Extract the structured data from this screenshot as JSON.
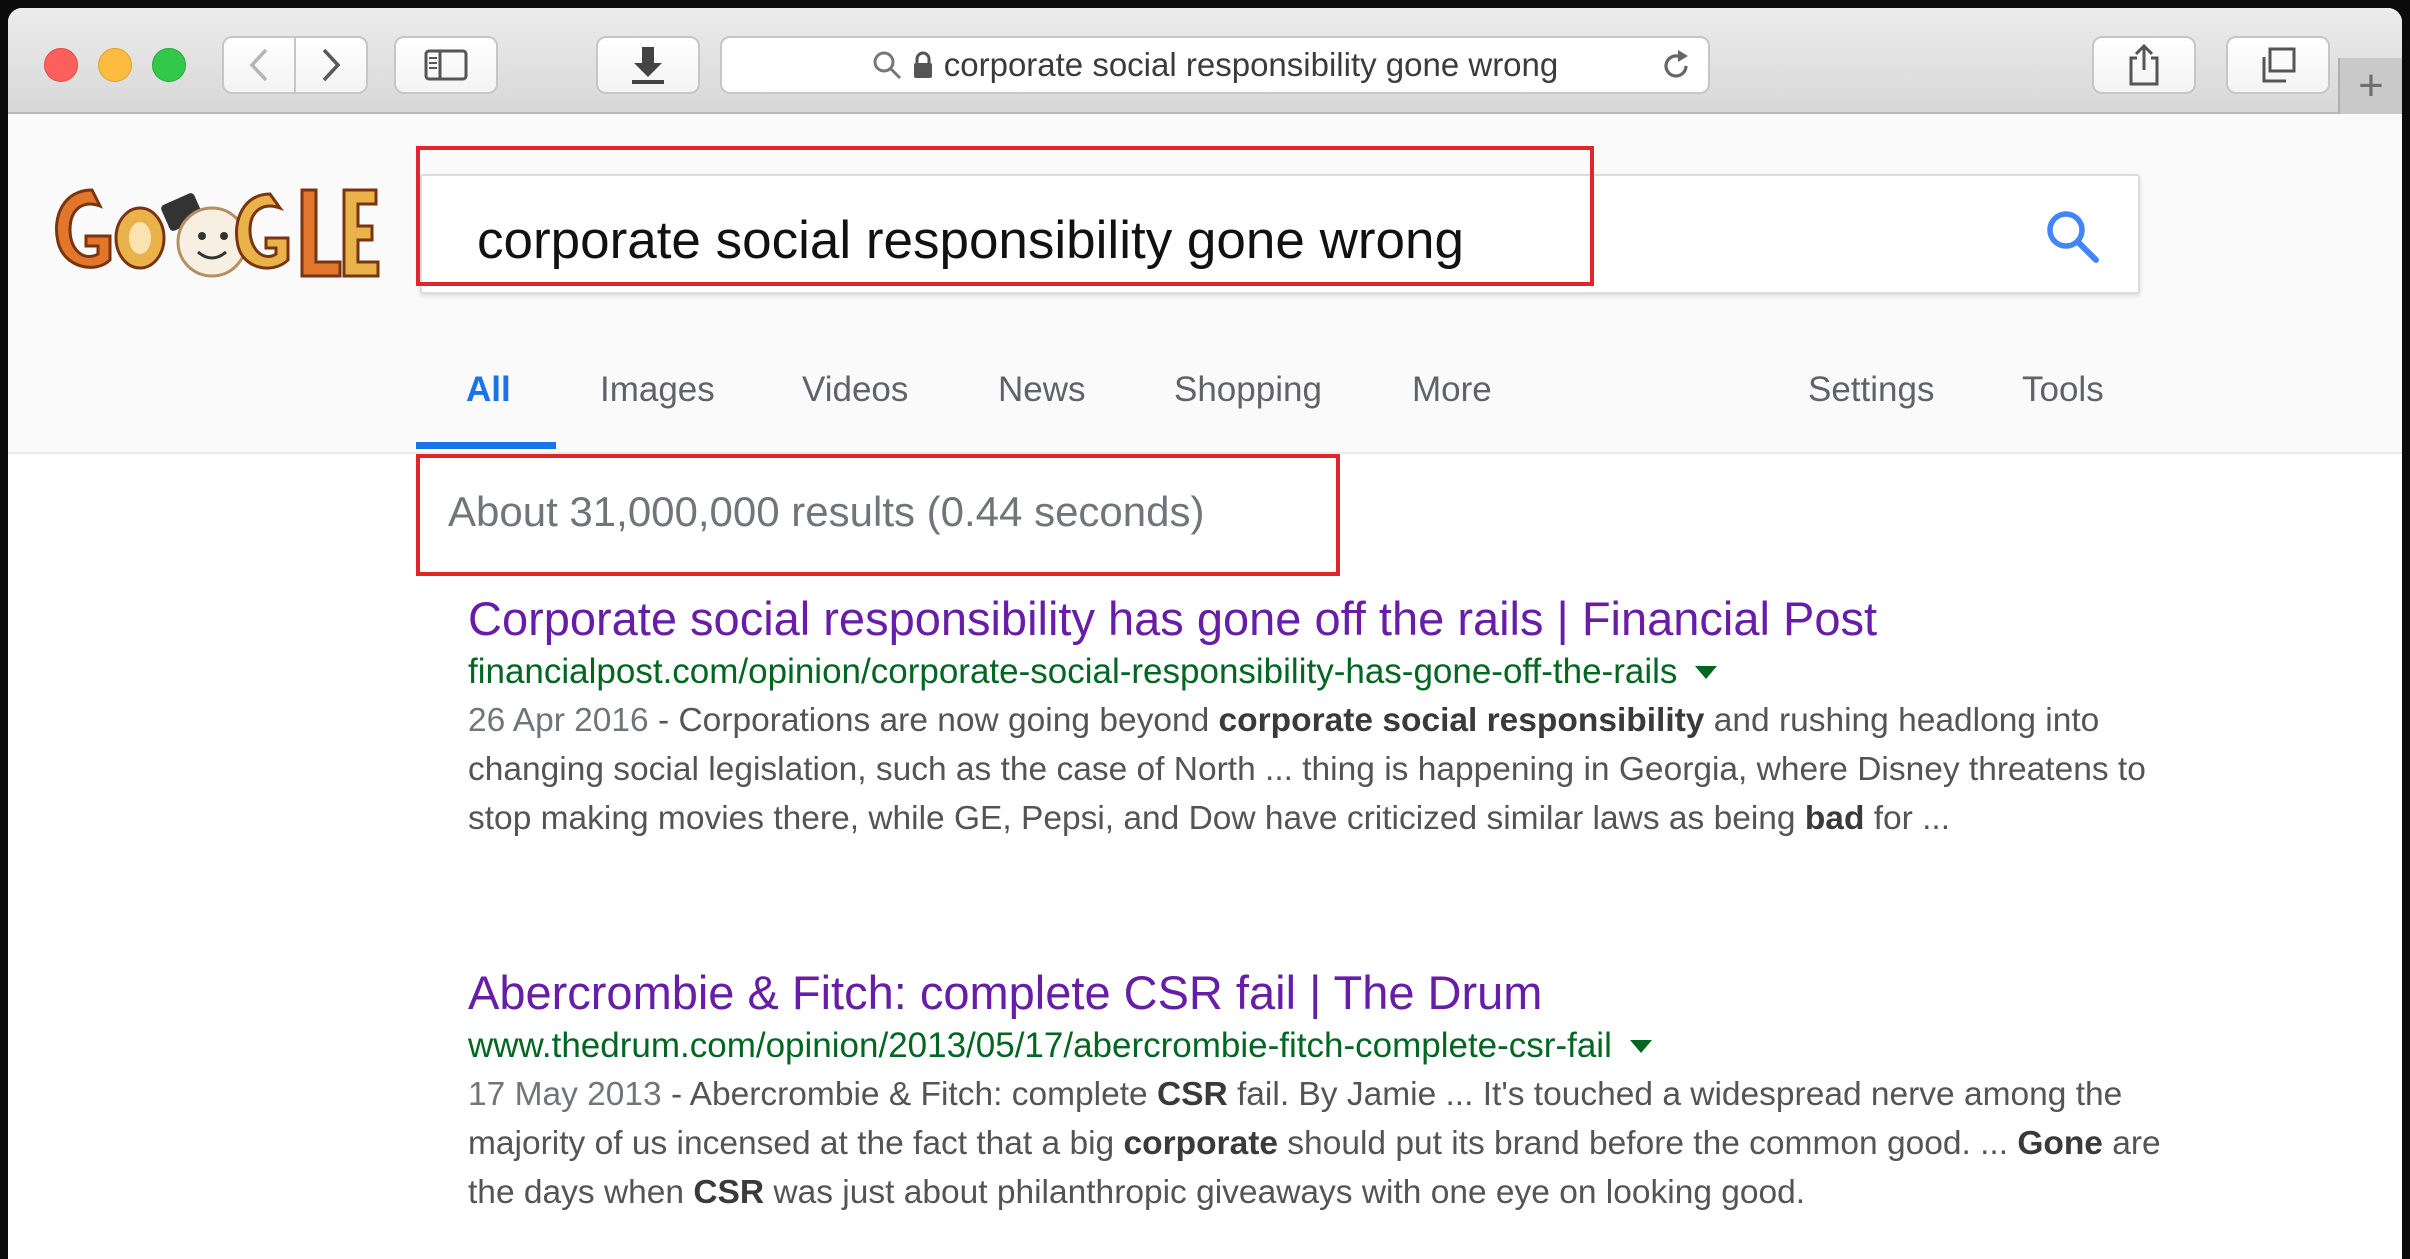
{
  "browser": {
    "address": "corporate social responsibility gone wrong",
    "new_tab_glyph": "+"
  },
  "google": {
    "query": "corporate social responsibility gone wrong",
    "tabs": [
      {
        "label": "All",
        "active": true
      },
      {
        "label": "Images"
      },
      {
        "label": "Videos"
      },
      {
        "label": "News"
      },
      {
        "label": "Shopping"
      },
      {
        "label": "More"
      },
      {
        "label": "Settings"
      },
      {
        "label": "Tools"
      }
    ],
    "stats": "About 31,000,000 results (0.44 seconds)"
  },
  "results": [
    {
      "title": "Corporate social responsibility has gone off the rails | Financial Post",
      "url": "financialpost.com/opinion/corporate-social-responsibility-has-gone-off-the-rails",
      "date": "26 Apr 2016",
      "snippet_parts": [
        {
          "t": " - Corporations are now going beyond "
        },
        {
          "t": "corporate social responsibility",
          "b": true
        },
        {
          "t": " and rushing headlong into changing social legislation, such as the case of North ... thing is happening in Georgia, where Disney threatens to stop making movies there, while GE, Pepsi, and Dow have criticized similar laws as being "
        },
        {
          "t": "bad",
          "b": true
        },
        {
          "t": " for ..."
        }
      ]
    },
    {
      "title": "Abercrombie & Fitch: complete CSR fail | The Drum",
      "url": "www.thedrum.com/opinion/2013/05/17/abercrombie-fitch-complete-csr-fail",
      "date": "17 May 2013",
      "snippet_parts": [
        {
          "t": " - Abercrombie & Fitch: complete "
        },
        {
          "t": "CSR",
          "b": true
        },
        {
          "t": " fail. By Jamie ... It's touched a widespread nerve among the majority of us incensed at the fact that a big "
        },
        {
          "t": "corporate",
          "b": true
        },
        {
          "t": " should put its brand before the common good. ... "
        },
        {
          "t": "Gone",
          "b": true
        },
        {
          "t": " are the days when "
        },
        {
          "t": "CSR",
          "b": true
        },
        {
          "t": " was just about philanthropic giveaways with one eye on looking good."
        }
      ]
    }
  ],
  "colors": {
    "accent_blue": "#1a73e8",
    "annotation_red": "#e0262b",
    "link_visited": "#681da8",
    "url_green": "#006621"
  }
}
